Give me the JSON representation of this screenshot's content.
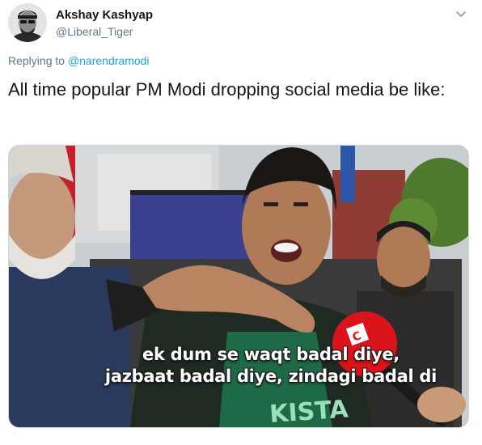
{
  "tweet": {
    "author": {
      "display_name": "Akshay Kashyap",
      "handle": "@Liberal_Tiger"
    },
    "replying_prefix": "Replying to",
    "replying_to": "@narendramodi",
    "text": "All time popular PM Modi dropping social media be like:",
    "media": {
      "subtitle_line1": "ek dum se waqt badal diye,",
      "subtitle_line2": "jazbaat badal diye, zindagi badal di",
      "mic_brand": "C",
      "shirt_text": "KISTA"
    }
  },
  "colors": {
    "link": "#1da1f2",
    "secondary_text": "#657786",
    "primary_text": "#14171a",
    "mic_red": "#d9141b"
  },
  "icons": {
    "caret": "chevron-down-icon"
  }
}
